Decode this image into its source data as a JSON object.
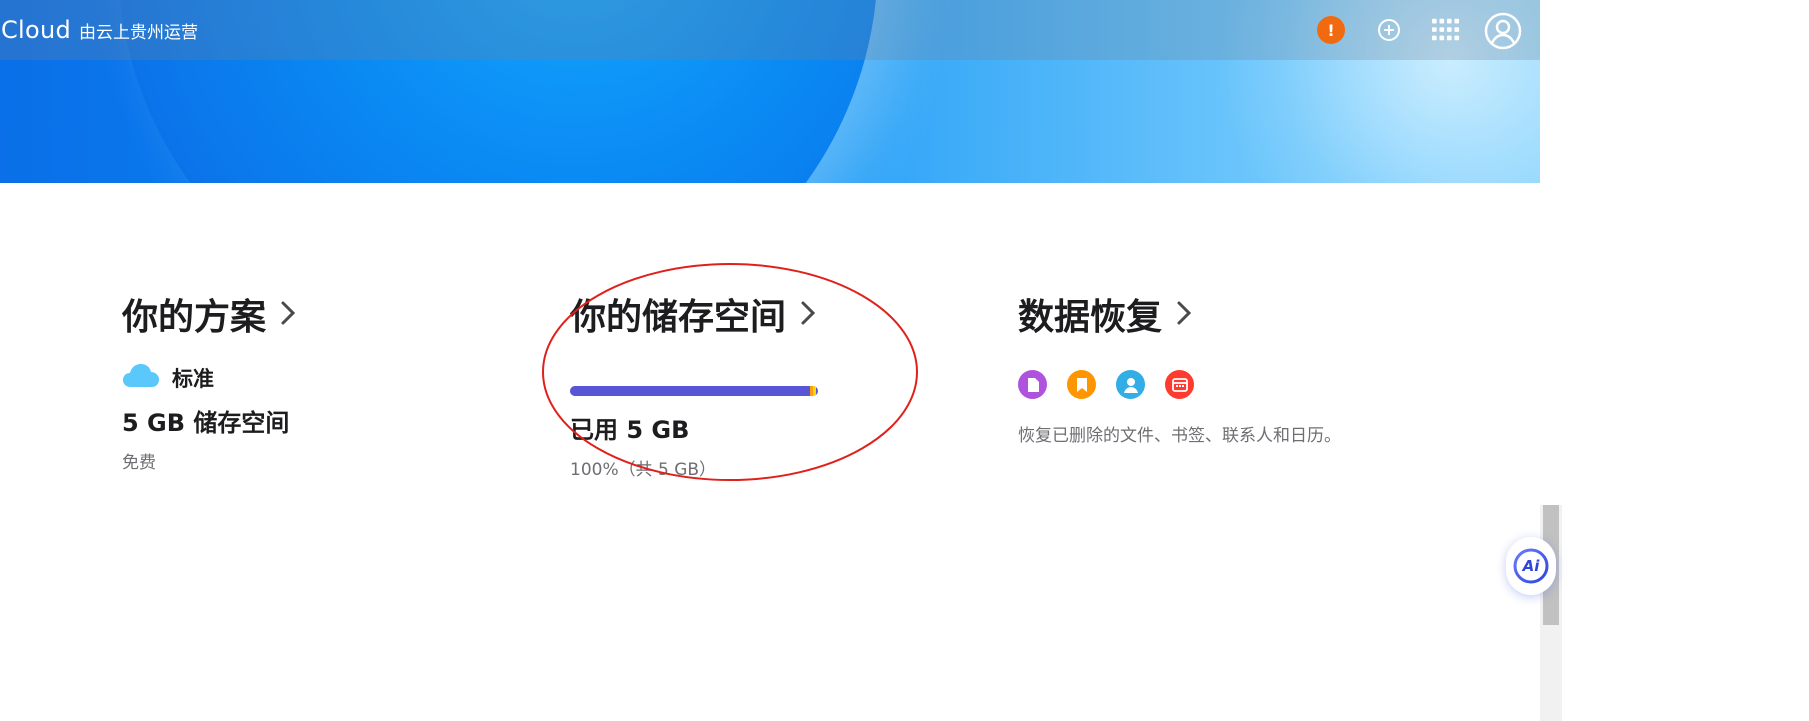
{
  "header": {
    "brand_name": "iCloud",
    "brand_sub": "由云上贵州运营",
    "alert_label": "!"
  },
  "plan_card": {
    "title": "你的方案",
    "tier": "标准",
    "storage": "5 GB 储存空间",
    "price": "免费"
  },
  "storage_card": {
    "title": "你的储存空间",
    "used": "已用 5 GB",
    "detail": "100%（共 5 GB）",
    "usage_fraction": 1.0
  },
  "recovery_card": {
    "title": "数据恢复",
    "description": "恢复已删除的文件、书签、联系人和日历。",
    "icons": [
      "file-icon",
      "bookmark-icon",
      "contact-icon",
      "calendar-icon"
    ]
  },
  "ai_button": {
    "label": "Ai"
  },
  "colors": {
    "bar_fill": "#5856d6",
    "file_icon": "#af52de",
    "bookmark_icon": "#ff9500",
    "contact_icon": "#32ade6",
    "calendar_icon": "#ff3b30",
    "annotation": "#e0201a"
  }
}
